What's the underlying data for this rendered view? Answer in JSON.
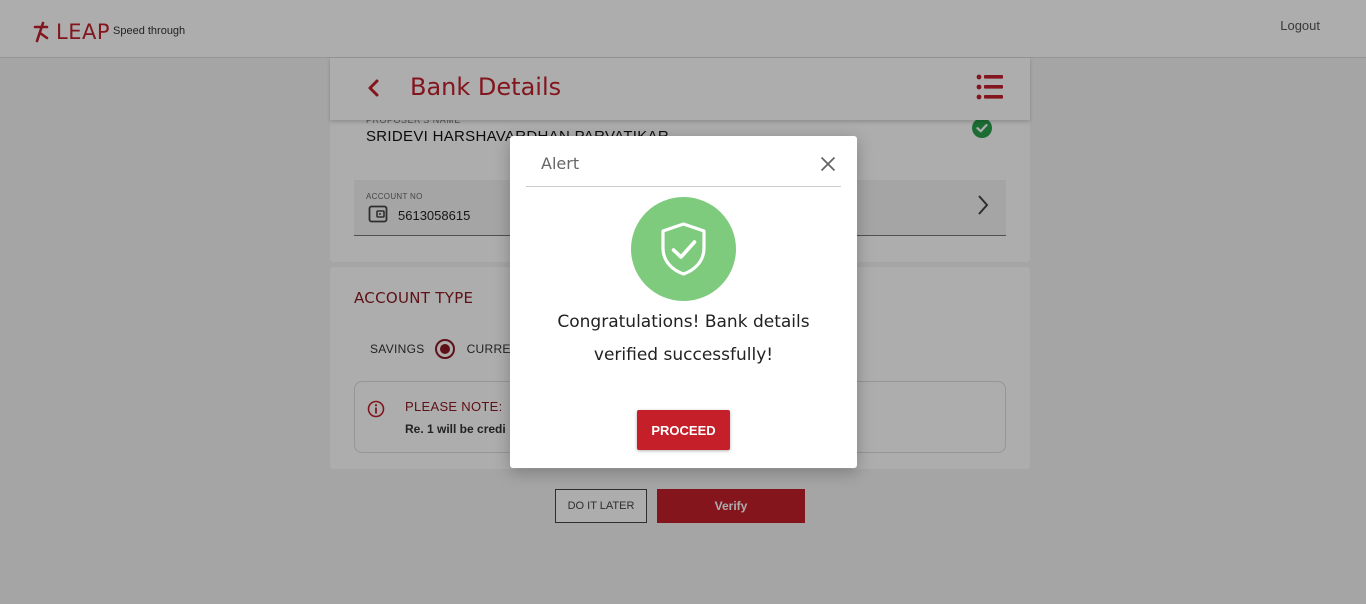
{
  "header": {
    "logo_text": "LEAP",
    "tagline": "Speed through",
    "logout_label": "Logout"
  },
  "page": {
    "title": "Bank Details"
  },
  "bank_card": {
    "proposer_label": "PROPOSER'S NAME",
    "proposer_name": "SRIDEVI HARSHAVARDHAN PARVATIKAR",
    "account_label": "ACCOUNT NO",
    "account_value": "5613058615"
  },
  "account_type": {
    "title": "ACCOUNT TYPE",
    "options": [
      "SAVINGS",
      "CURRENT"
    ],
    "selected": "SAVINGS",
    "note_title": "PLEASE NOTE:",
    "note_text": "Re. 1 will be credi"
  },
  "actions": {
    "later_label": "DO IT LATER",
    "verify_label": "Verify"
  },
  "modal": {
    "title": "Alert",
    "message_line1": "Congratulations! Bank details",
    "message_line2": "verified successfully!",
    "proceed_label": "PROCEED"
  },
  "colors": {
    "brand_red": "#c51f2a",
    "dark_red": "#8b1a22",
    "success_green": "#7ecb7e",
    "check_green": "#2aa14d"
  },
  "icons": {
    "back": "chevron-left-icon",
    "menu": "list-menu-icon",
    "verified": "check-circle-icon",
    "wallet": "wallet-icon",
    "chevron": "chevron-right-icon",
    "info": "info-icon",
    "close": "close-icon",
    "shield": "shield-check-icon"
  }
}
